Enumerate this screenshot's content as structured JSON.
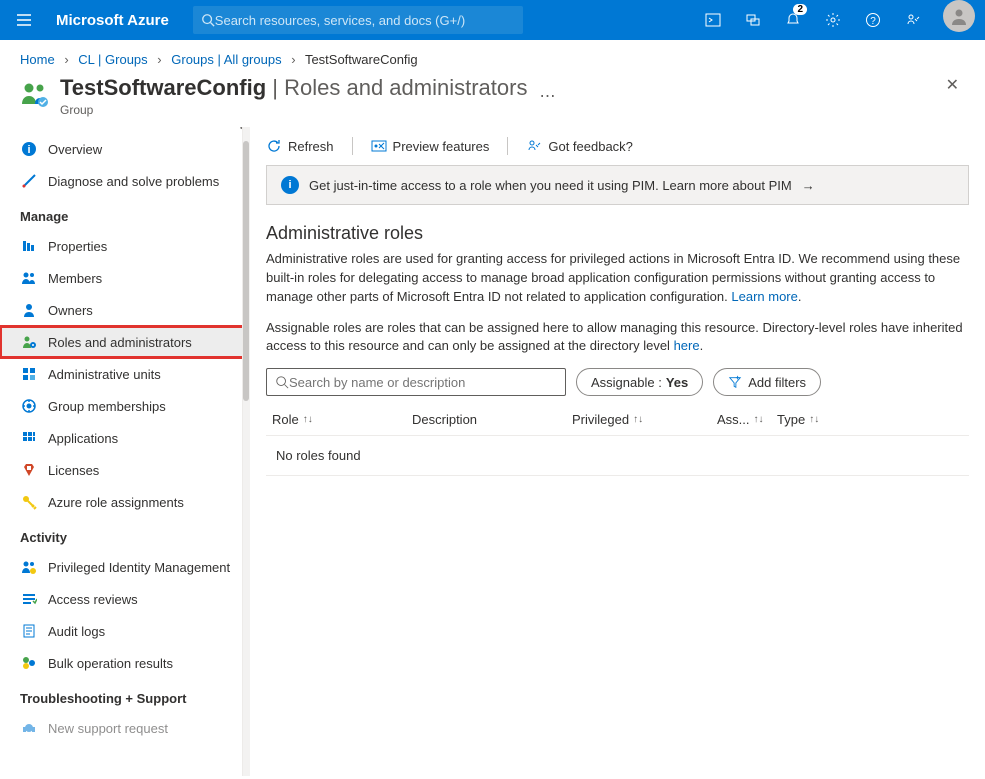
{
  "topbar": {
    "brand": "Microsoft Azure",
    "search_placeholder": "Search resources, services, and docs (G+/)",
    "notification_count": "2"
  },
  "breadcrumb": {
    "items": [
      "Home",
      "CL | Groups",
      "Groups | All groups",
      "TestSoftwareConfig"
    ]
  },
  "header": {
    "title": "TestSoftwareConfig",
    "subtitle": "Roles and administrators",
    "type": "Group"
  },
  "sidebar": {
    "top": [
      {
        "label": "Overview"
      },
      {
        "label": "Diagnose and solve problems"
      }
    ],
    "manage_label": "Manage",
    "manage": [
      {
        "label": "Properties"
      },
      {
        "label": "Members"
      },
      {
        "label": "Owners"
      },
      {
        "label": "Roles and administrators"
      },
      {
        "label": "Administrative units"
      },
      {
        "label": "Group memberships"
      },
      {
        "label": "Applications"
      },
      {
        "label": "Licenses"
      },
      {
        "label": "Azure role assignments"
      }
    ],
    "activity_label": "Activity",
    "activity": [
      {
        "label": "Privileged Identity Management"
      },
      {
        "label": "Access reviews"
      },
      {
        "label": "Audit logs"
      },
      {
        "label": "Bulk operation results"
      }
    ],
    "support_label": "Troubleshooting + Support",
    "support": [
      {
        "label": "New support request"
      }
    ]
  },
  "toolbar": {
    "refresh": "Refresh",
    "preview": "Preview features",
    "feedback": "Got feedback?"
  },
  "banner": {
    "text": "Get just-in-time access to a role when you need it using PIM. Learn more about PIM"
  },
  "content": {
    "heading": "Administrative roles",
    "para1a": "Administrative roles are used for granting access for privileged actions in Microsoft Entra ID. We recommend using these built-in roles for delegating access to manage broad application configuration permissions without granting access to manage other parts of Microsoft Entra ID not related to application configuration. ",
    "learn_more": "Learn more",
    "para2a": "Assignable roles are roles that can be assigned here to allow managing this resource. Directory-level roles have inherited access to this resource and can only be assigned at the directory level ",
    "here": "here",
    "search_placeholder": "Search by name or description",
    "assignable_label": "Assignable : ",
    "assignable_value": "Yes",
    "add_filters": "Add filters",
    "columns": {
      "role": "Role",
      "desc": "Description",
      "priv": "Privileged",
      "ass": "Ass...",
      "type": "Type"
    },
    "empty": "No roles found"
  }
}
